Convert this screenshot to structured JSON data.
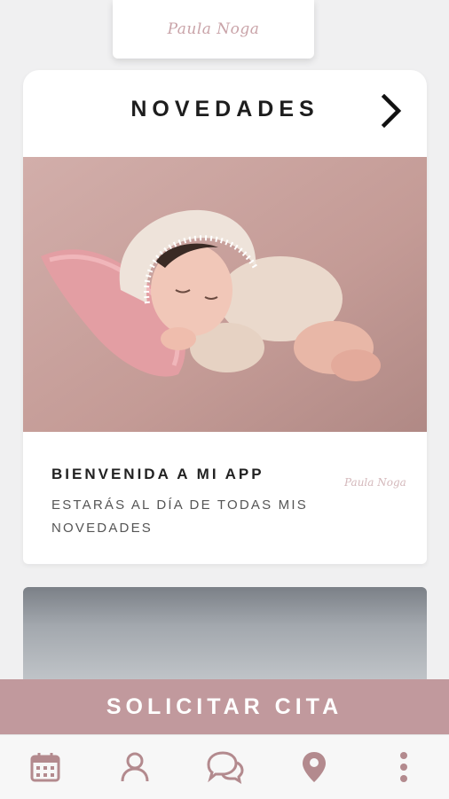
{
  "brand": {
    "logo_text": "Paula Noga",
    "accent_color": "#c1999d",
    "icon_color": "#b38a8e"
  },
  "news": {
    "title": "NOVEDADES",
    "next_icon": "chevron-right-icon",
    "post": {
      "image_alt": "baby sleeping on pink pillow",
      "title": "BIENVENIDA A MI APP",
      "description": "ESTARÁS AL DÍA DE TODAS MIS NOVEDADES",
      "logo_text": "Paula Noga"
    }
  },
  "cta": {
    "label": "SOLICITAR CITA"
  },
  "bottom_nav": {
    "items": [
      {
        "icon": "calendar-icon"
      },
      {
        "icon": "user-icon"
      },
      {
        "icon": "chat-bubbles-icon"
      },
      {
        "icon": "location-pin-icon"
      },
      {
        "icon": "more-vertical-icon"
      }
    ]
  }
}
